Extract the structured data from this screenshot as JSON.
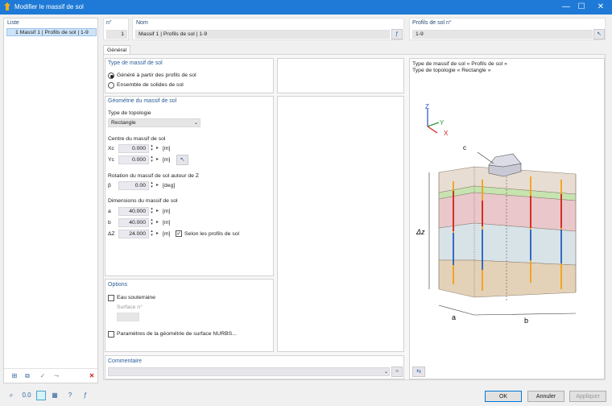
{
  "window": {
    "title": "Modifier le massif de sol",
    "minimize": "—",
    "maximize": "☐",
    "close": "✕"
  },
  "list": {
    "header": "Liste",
    "items": [
      {
        "label": "1  Massif 1 | Profils de sol | 1-9"
      }
    ]
  },
  "header": {
    "n_label": "n°",
    "n_value": "1",
    "name_label": "Nom",
    "name_value": "Massif 1 | Profils de sol | 1-9",
    "profiles_label": "Profils de sol n°",
    "profiles_value": "1-9"
  },
  "tabs": [
    {
      "label": "Général"
    }
  ],
  "type_section": {
    "title": "Type de massif de sol",
    "options": [
      "Généré à partir des profils de sol",
      "Ensemble de solides de sol"
    ]
  },
  "geometry": {
    "title": "Géométrie du massif de sol",
    "topology_label": "Type de topologie",
    "topology_value": "Rectangle",
    "center_label": "Centre du massif de sol",
    "xc_label": "Xc",
    "xc_value": "0.000",
    "yc_label": "Yc",
    "yc_value": "0.000",
    "unit_m": "[m]",
    "rotation_label": "Rotation du massif de sol autour de Z",
    "beta_label": "β",
    "beta_value": "0.00",
    "unit_deg": "[deg]",
    "dims_label": "Dimensions du massif de sol",
    "a_label": "a",
    "a_value": "40.000",
    "b_label": "b",
    "b_value": "40.000",
    "dz_label": "ΔZ",
    "dz_value": "24.000",
    "according_label": "Selon les profils de sol"
  },
  "options": {
    "title": "Options",
    "groundwater_label": "Eau souterraine",
    "surface_label": "Surface n°",
    "nurbs_label": "Paramètres de la géométrie de surface NURBS..."
  },
  "comment": {
    "title": "Commentaire"
  },
  "preview": {
    "line1": "Type de massif de sol « Profils de sol »",
    "line2": "Type de topologie « Rectangle »",
    "axis_z": "Z",
    "axis_y": "Y",
    "axis_x": "X",
    "label_c": "c",
    "label_dz": "Δz",
    "label_a": "a",
    "label_b": "b"
  },
  "footer": {
    "ok": "OK",
    "cancel": "Annuler",
    "apply": "Appliquer"
  },
  "colors": {
    "accent": "#1e7ad6",
    "section": "#2b5c99"
  }
}
